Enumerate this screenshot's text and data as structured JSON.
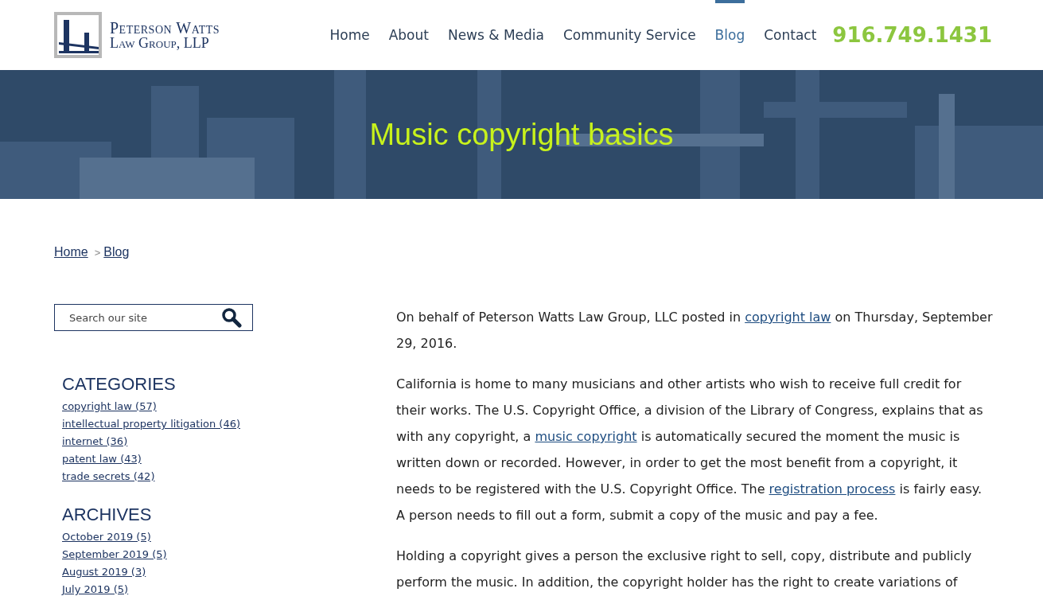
{
  "header": {
    "logo": {
      "name": "Peterson Watts",
      "subtitle": "Law Group, LLP"
    },
    "nav": [
      {
        "label": "Home",
        "selected": false
      },
      {
        "label": "About",
        "selected": false
      },
      {
        "label": "News & Media",
        "selected": false
      },
      {
        "label": "Community Service",
        "selected": false
      },
      {
        "label": "Blog",
        "selected": true
      },
      {
        "label": "Contact",
        "selected": false
      }
    ],
    "phone": "916.749.1431"
  },
  "hero": {
    "title": "Music copyright basics"
  },
  "breadcrumb": {
    "items": [
      "Home",
      "Blog"
    ],
    "separator": ">"
  },
  "sidebar": {
    "search": {
      "placeholder": "Search our site"
    },
    "sections": [
      {
        "heading": "CATEGORIES",
        "links": [
          "copyright law (57)",
          "intellectual property litigation (46)",
          "internet (36)",
          "patent law (43)",
          "trade secrets (42)"
        ]
      },
      {
        "heading": "ARCHIVES",
        "links": [
          "October 2019 (5)",
          "September 2019 (5)",
          "August 2019 (3)",
          "July 2019 (5)"
        ]
      }
    ]
  },
  "article": {
    "paragraphs": [
      [
        {
          "kind": "text",
          "text": "On behalf of Peterson Watts Law Group, LLC posted in "
        },
        {
          "kind": "link",
          "text": "copyright law"
        },
        {
          "kind": "text",
          "text": " on Thursday, September 29, 2016."
        }
      ],
      [
        {
          "kind": "text",
          "text": "California is home to many musicians and other artists who wish to receive full credit for their works. The U.S. Copyright Office, a division of the Library of Congress, explains that as with any copyright, a "
        },
        {
          "kind": "link",
          "text": "music copyright"
        },
        {
          "kind": "text",
          "text": " is automatically secured the moment the music is written down or recorded. However, in order to get the most benefit from a copyright, it needs to be registered with the U.S. Copyright Office. The "
        },
        {
          "kind": "link",
          "text": "registration process"
        },
        {
          "kind": "text",
          "text": " is fairly easy. A person needs to fill out a form, submit a copy of the music and pay a fee."
        }
      ],
      [
        {
          "kind": "text",
          "text": "Holding a copyright gives a person the exclusive right to sell, copy, distribute and publicly perform the music. In addition, the copyright holder has the right to create variations of"
        }
      ]
    ]
  }
}
